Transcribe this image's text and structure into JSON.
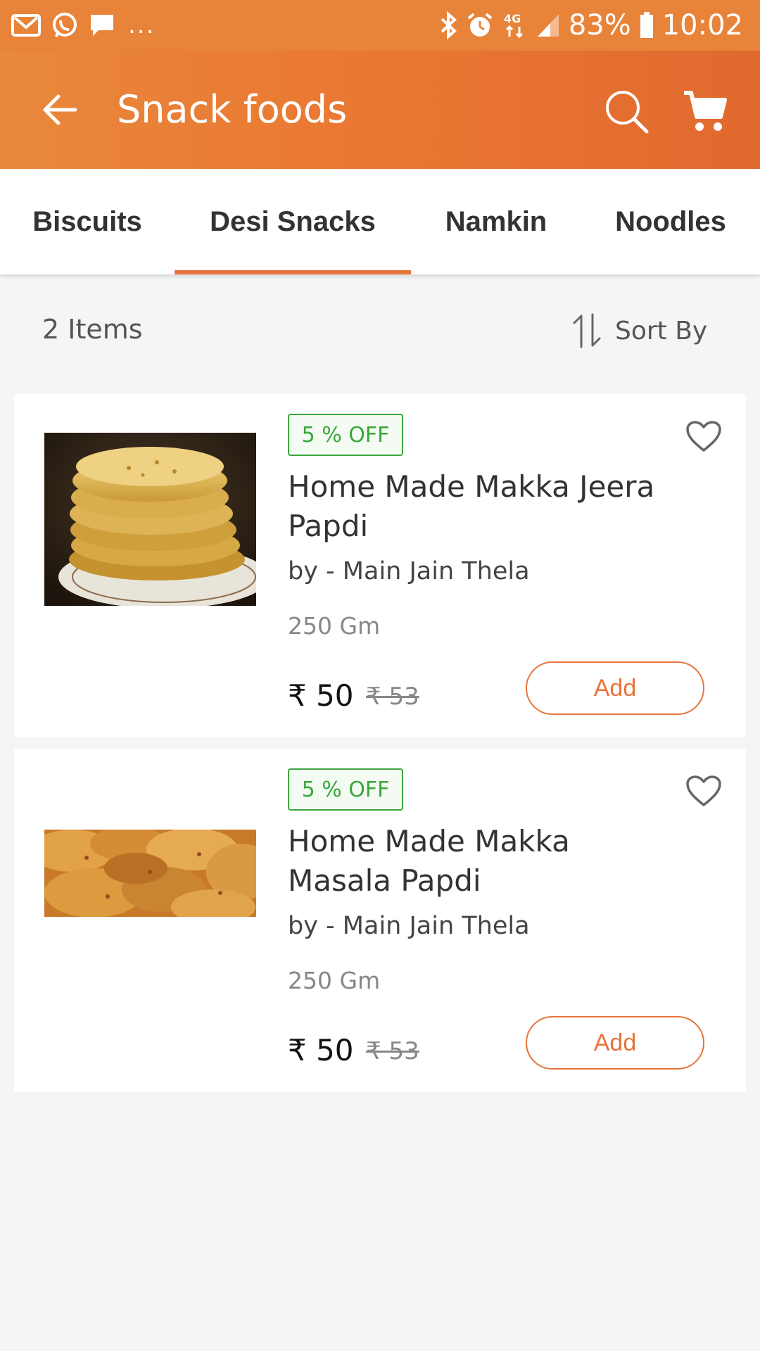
{
  "status_bar": {
    "battery": "83%",
    "time": "10:02",
    "network": "4G",
    "overflow": "...",
    "icons": [
      "gmail-icon",
      "whatsapp-icon",
      "message-icon",
      "bluetooth-icon",
      "alarm-icon",
      "network-4g-icon",
      "signal-icon",
      "battery-icon"
    ]
  },
  "app_bar": {
    "title": "Snack foods",
    "background": "#e8833a"
  },
  "tabs": [
    {
      "label": "Biscuits",
      "active": false
    },
    {
      "label": "Desi Snacks",
      "active": true
    },
    {
      "label": "Namkin",
      "active": false
    },
    {
      "label": "Noodles",
      "active": false
    }
  ],
  "listing": {
    "count_label": "2 Items",
    "sort_label": "Sort By"
  },
  "products": [
    {
      "discount": "5 % OFF",
      "name": "Home Made Makka Jeera Papdi",
      "vendor": "by - Main Jain Thela",
      "quantity": "250 Gm",
      "price": "₹ 50",
      "mrp": "₹ 53",
      "add_label": "Add"
    },
    {
      "discount": "5 % OFF",
      "name": "Home Made Makka Masala Papdi",
      "vendor": "by - Main Jain Thela",
      "quantity": "250 Gm",
      "price": "₹ 50",
      "mrp": "₹ 53",
      "add_label": "Add"
    }
  ],
  "colors": {
    "accent": "#e8733a",
    "discount_green": "#3aa63a"
  }
}
